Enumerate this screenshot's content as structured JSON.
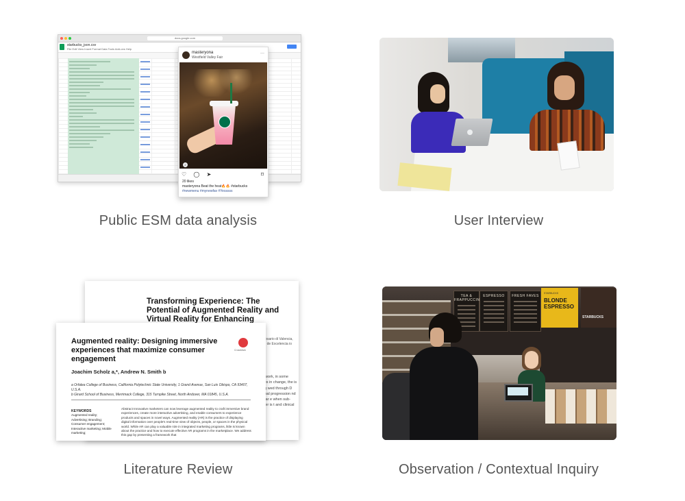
{
  "captions": {
    "esm": "Public ESM data analysis",
    "interview": "User Interview",
    "literature": "Literature Review",
    "observation": "Observation / Contextual Inquiry"
  },
  "spreadsheet": {
    "doc_name": "starbucks_json.csv",
    "url": "docs.google.com",
    "menus": "File  Edit  View  Insert  Format  Data  Tools  Add-ons  Help"
  },
  "instagram": {
    "username": "masteryona",
    "location": "Westfield Valley Fair",
    "more_icon": "ellipsis-icon",
    "badge": "2",
    "action_icons": "♡ ◯ ➤",
    "bookmark_icon": "⌑",
    "likes": "20 likes",
    "caption": "masteryona Beat the heat🔥🔥 #starbucks",
    "hashtags": "#newmenu #mynewfav #Yesssss"
  },
  "paper_back": {
    "title": "Transforming Experience: The Potential of Augmented Reality and Virtual Reality for Enhancing",
    "side_text_top": "and\n\nrd Rosario di Valencia, Valencia, de Excelencia io Brossa",
    "side_text_body": "school, work, in some advances in change, the is reducing wed through D an internal progression nd non-linear e when sub- this paper is t and clinical"
  },
  "paper_front": {
    "title": "Augmented reality: Designing immersive experiences that maximize consumer engagement",
    "crossmark_label": "CrossMark",
    "authors": "Joachim Scholz a,*, Andrew N. Smith b",
    "affiliation_a": "a Orfalea College of Business, California Polytechnic State University, 1 Grand Avenue, San Luis Obispo, CA 93407, U.S.A.",
    "affiliation_b": "b Girard School of Business, Merrimack College, 315 Turnpike Street, North Andover, MA 01845, U.S.A.",
    "keywords_heading": "KEYWORDS",
    "keywords": "Augmented reality; Advertising; Branding; Consumer engagement; Interactive marketing; Mobile marketing;",
    "abstract": "Abstract Innovative marketers can now leverage augmented reality to craft immersive brand experiences, create more interactive advertising, and enable consumers to experience products and spaces in novel ways. Augmented reality (AR) is the practice of displaying digital information over people's real-time view of objects, people, or spaces in the physical world. While AR can play a valuable role in integrated marketing programs, little is known about the practice and how to execute effective AR programs in the marketplace. We address this gap by presenting a framework that"
  },
  "store": {
    "menu_1": "TEA & FRAPPUCCINO",
    "menu_2": "ESPRESSO",
    "menu_3": "FRESH FAVES",
    "blonde_small": "STARBUCKS",
    "blonde_title": "BLONDE ESPRESSO",
    "sbux_label": "STARBUCKS"
  }
}
